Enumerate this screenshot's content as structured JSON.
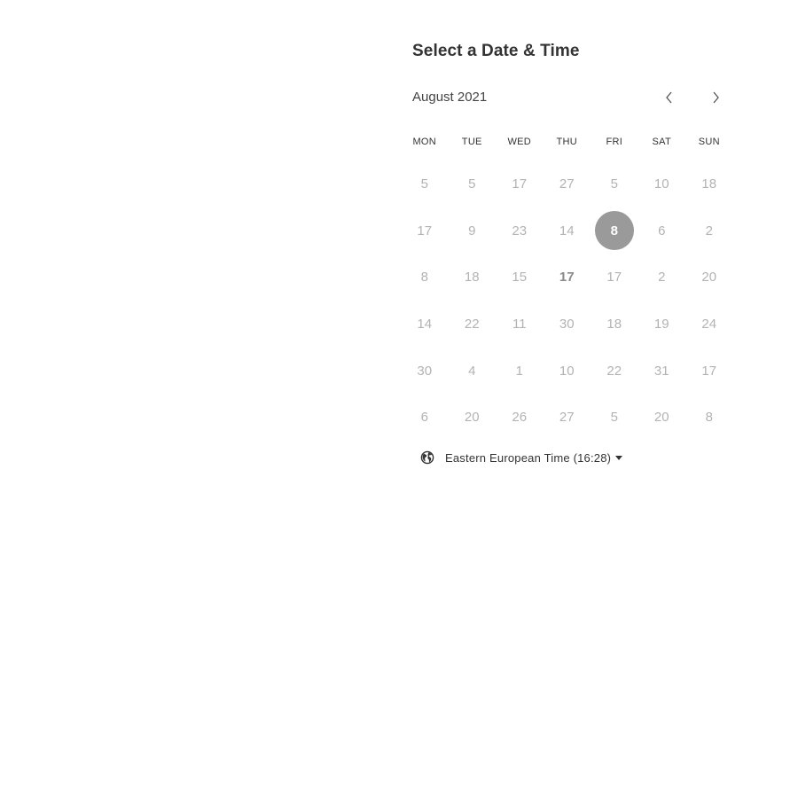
{
  "header": {
    "title": "Select a Date & Time"
  },
  "calendar": {
    "month_label": "August 2021",
    "prev_icon": "chevron-left-icon",
    "next_icon": "chevron-right-icon",
    "weekdays": [
      "MON",
      "TUE",
      "WED",
      "THU",
      "FRI",
      "SAT",
      "SUN"
    ],
    "weeks": [
      [
        "5",
        "5",
        "17",
        "27",
        "5",
        "10",
        "18"
      ],
      [
        "17",
        "9",
        "23",
        "14",
        "8",
        "6",
        "2"
      ],
      [
        "8",
        "18",
        "15",
        "17",
        "17",
        "2",
        "20"
      ],
      [
        "14",
        "22",
        "11",
        "30",
        "18",
        "19",
        "24"
      ],
      [
        "30",
        "4",
        "1",
        "10",
        "22",
        "31",
        "17"
      ],
      [
        "6",
        "20",
        "26",
        "27",
        "5",
        "20",
        "8"
      ]
    ],
    "selected_cell": {
      "week": 1,
      "day": 4
    },
    "bold_cell": {
      "week": 2,
      "day": 3
    }
  },
  "timezone": {
    "icon": "globe-icon",
    "label": "Eastern European Time (16:28)",
    "caret_icon": "caret-down-icon"
  },
  "colors": {
    "selected_bg": "#9a9a9a",
    "muted_text": "#b3b3b3"
  }
}
